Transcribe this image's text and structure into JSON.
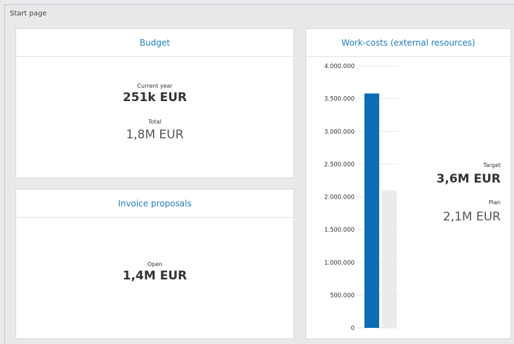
{
  "page": {
    "title": "Start page"
  },
  "budget": {
    "title": "Budget",
    "current_year_label": "Current year",
    "current_year_value": "251k EUR",
    "total_label": "Total",
    "total_value": "1,8M EUR"
  },
  "invoice": {
    "title": "Invoice proposals",
    "open_label": "Open",
    "open_value": "1,4M EUR"
  },
  "workcosts": {
    "title": "Work-costs (external resources)",
    "target_label": "Target",
    "target_value": "3,6M EUR",
    "plan_label": "Plan",
    "plan_value": "2,1M EUR"
  },
  "chart_data": {
    "type": "bar",
    "categories": [
      "Target",
      "Plan"
    ],
    "values": [
      3580000,
      2100000
    ],
    "colors": [
      "#0a6db5",
      "#ebebeb"
    ],
    "ylim": [
      0,
      4000000
    ],
    "yticks": [
      "0",
      "500.000",
      "1.000.000",
      "1.500.000",
      "2.000.000",
      "2.500.000",
      "3.000.000",
      "3.500.000",
      "4.000.000"
    ],
    "grid": true
  }
}
